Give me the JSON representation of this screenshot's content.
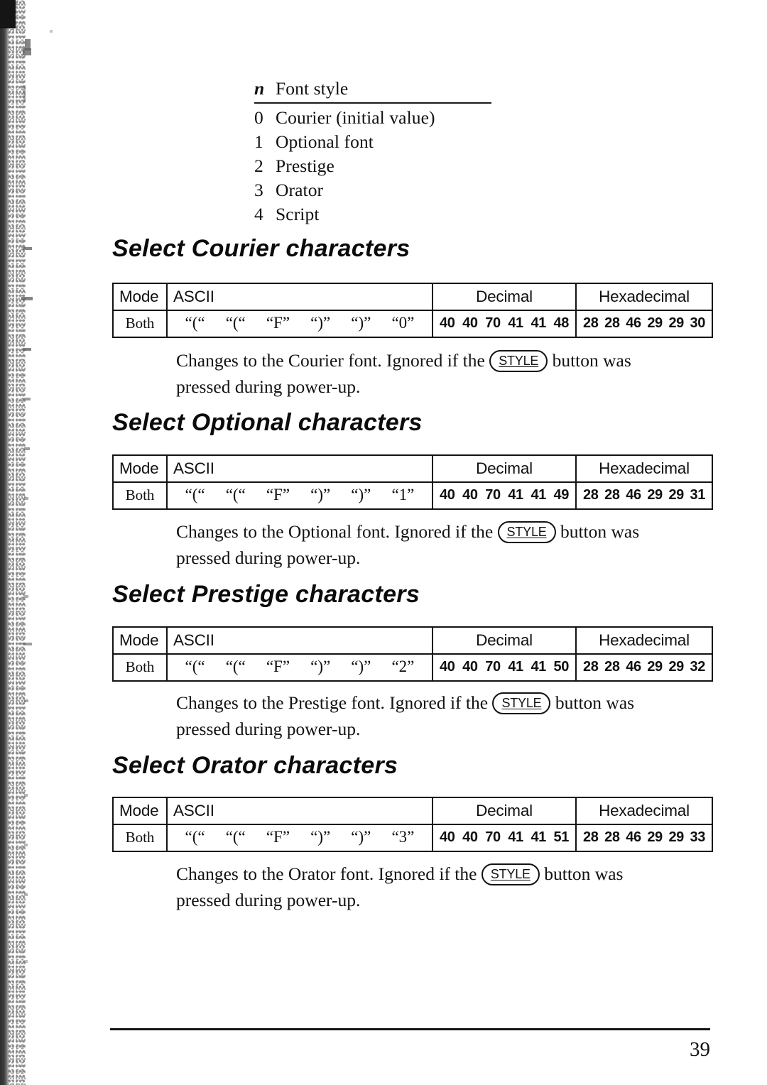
{
  "document": {
    "page_number": "39"
  },
  "font_style_list": {
    "header": {
      "n": "n",
      "label": "Font style"
    },
    "rows": [
      {
        "n": "0",
        "label": "Courier (initial value)"
      },
      {
        "n": "1",
        "label": "Optional font"
      },
      {
        "n": "2",
        "label": "Prestige"
      },
      {
        "n": "3",
        "label": "Orator"
      },
      {
        "n": "4",
        "label": "Script"
      }
    ]
  },
  "table_headers": {
    "mode": "Mode",
    "ascii": "ASCII",
    "decimal": "Decimal",
    "hexadecimal": "Hexadecimal"
  },
  "sections": [
    {
      "title": "Select Courier characters",
      "table": {
        "mode": "Both",
        "ascii": [
          "“(“",
          "“(“",
          "“F”",
          "“)”",
          "“)”",
          "“0”"
        ],
        "decimal": [
          "40",
          "40",
          "70",
          "41",
          "41",
          "48"
        ],
        "hexadecimal": [
          "28",
          "28",
          "46",
          "29",
          "29",
          "30"
        ]
      },
      "note": {
        "before_key": "Changes to the Courier font. Ignored if the",
        "key": "STYLE",
        "after_key": "button was",
        "line2": "pressed during power-up."
      }
    },
    {
      "title": "Select Optional characters",
      "table": {
        "mode": "Both",
        "ascii": [
          "“(“",
          "“(“",
          "“F”",
          "“)”",
          "“)”",
          "“1”"
        ],
        "decimal": [
          "40",
          "40",
          "70",
          "41",
          "41",
          "49"
        ],
        "hexadecimal": [
          "28",
          "28",
          "46",
          "29",
          "29",
          "31"
        ]
      },
      "note": {
        "before_key": "Changes to the Optional font. Ignored if the",
        "key": "STYLE",
        "after_key": "button was",
        "line2": "pressed during power-up."
      }
    },
    {
      "title": "Select Prestige characters",
      "table": {
        "mode": "Both",
        "ascii": [
          "“(“",
          "“(“",
          "“F”",
          "“)”",
          "“)”",
          "“2”"
        ],
        "decimal": [
          "40",
          "40",
          "70",
          "41",
          "41",
          "50"
        ],
        "hexadecimal": [
          "28",
          "28",
          "46",
          "29",
          "29",
          "32"
        ]
      },
      "note": {
        "before_key": "Changes to the Prestige font. Ignored if the",
        "key": "STYLE",
        "after_key": "button was",
        "line2": "pressed during power-up."
      }
    },
    {
      "title": "Select Orator characters",
      "table": {
        "mode": "Both",
        "ascii": [
          "“(“",
          "“(“",
          "“F”",
          "“)”",
          "“)”",
          "“3”"
        ],
        "decimal": [
          "40",
          "40",
          "70",
          "41",
          "41",
          "51"
        ],
        "hexadecimal": [
          "28",
          "28",
          "46",
          "29",
          "29",
          "33"
        ]
      },
      "note": {
        "before_key": "Changes to the Orator font. Ignored if the",
        "key": "STYLE",
        "after_key": "button was",
        "line2": "pressed during power-up."
      }
    }
  ]
}
